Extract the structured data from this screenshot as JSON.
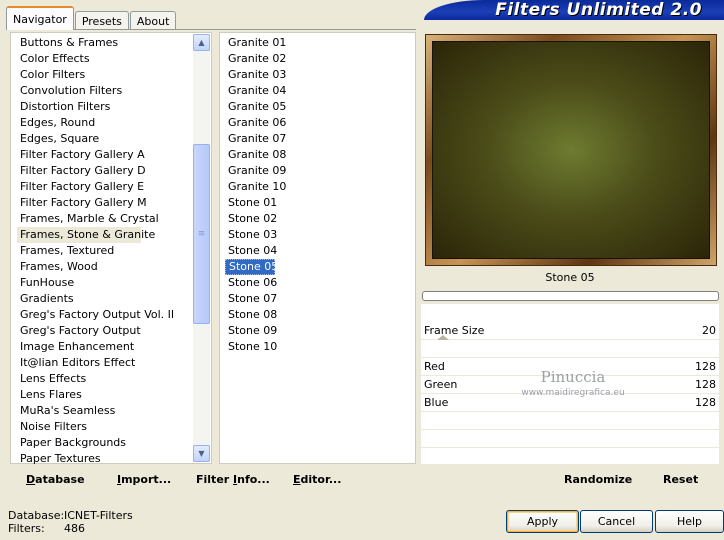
{
  "banner": {
    "title": "Filters Unlimited 2.0"
  },
  "tabs": [
    {
      "label": "Navigator",
      "active": true
    },
    {
      "label": "Presets",
      "active": false
    },
    {
      "label": "About",
      "active": false
    }
  ],
  "categories": {
    "selected": "Frames, Stone & Granite",
    "items": [
      "Buttons & Frames",
      "Color Effects",
      "Color Filters",
      "Convolution Filters",
      "Distortion Filters",
      "Edges, Round",
      "Edges, Square",
      "Filter Factory Gallery A",
      "Filter Factory Gallery D",
      "Filter Factory Gallery E",
      "Filter Factory Gallery M",
      "Frames, Marble & Crystal",
      "Frames, Stone & Granite",
      "Frames, Textured",
      "Frames, Wood",
      "FunHouse",
      "Gradients",
      "Greg's Factory Output Vol. II",
      "Greg's Factory Output",
      "Image Enhancement",
      "It@lian Editors Effect",
      "Lens Effects",
      "Lens Flares",
      "MuRa's Seamless",
      "Noise Filters",
      "Paper Backgrounds",
      "Paper Textures"
    ]
  },
  "filters": {
    "selected": "Stone 05",
    "items": [
      "Granite 01",
      "Granite 02",
      "Granite 03",
      "Granite 04",
      "Granite 05",
      "Granite 06",
      "Granite 07",
      "Granite 08",
      "Granite 09",
      "Granite 10",
      "Stone 01",
      "Stone 02",
      "Stone 03",
      "Stone 04",
      "Stone 05",
      "Stone 06",
      "Stone 07",
      "Stone 08",
      "Stone 09",
      "Stone 10"
    ]
  },
  "preview": {
    "filter_name": "Stone 05"
  },
  "params": {
    "frame_size": {
      "label": "Frame Size",
      "value": "20"
    },
    "red": {
      "label": "Red",
      "value": "128"
    },
    "green": {
      "label": "Green",
      "value": "128"
    },
    "blue": {
      "label": "Blue",
      "value": "128"
    }
  },
  "watermark": {
    "name": "Pinuccia",
    "url": "www.maidiregrafica.eu"
  },
  "toolbar_left": {
    "database": {
      "mn": "D",
      "rest": "atabase"
    },
    "import": {
      "mn": "I",
      "rest": "mport..."
    },
    "filter_info": {
      "pre": "Filter ",
      "mn": "I",
      "rest": "nfo..."
    },
    "editor": {
      "mn": "E",
      "rest": "ditor..."
    }
  },
  "toolbar_right": {
    "randomize": "Randomize",
    "reset": "Reset"
  },
  "status": {
    "database_label": "Database:",
    "database_value": "ICNET-Filters",
    "filters_label": "Filters:",
    "filters_value": "486"
  },
  "buttons": {
    "apply": "Apply",
    "cancel": "Cancel",
    "help": "Help"
  },
  "colors": {
    "selection": "#316ac5",
    "banner": "#1c3fb8",
    "default_button_ring": "#f8b33a"
  }
}
